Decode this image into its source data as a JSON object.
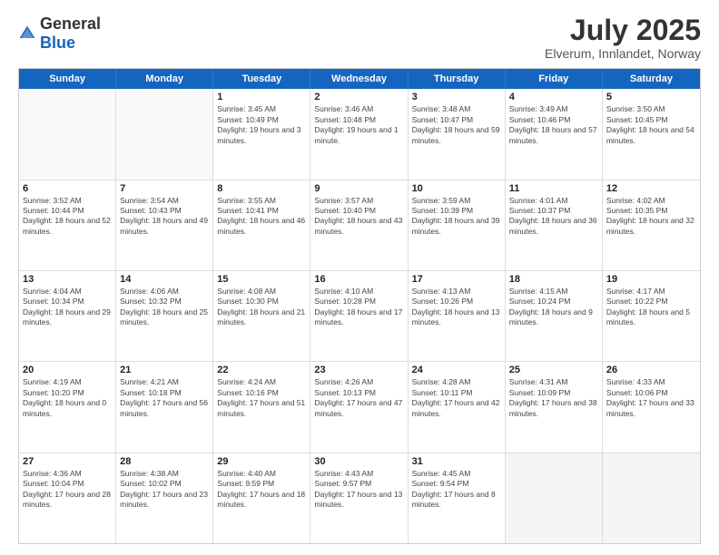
{
  "logo": {
    "general": "General",
    "blue": "Blue"
  },
  "header": {
    "month": "July 2025",
    "location": "Elverum, Innlandet, Norway"
  },
  "days_of_week": [
    "Sunday",
    "Monday",
    "Tuesday",
    "Wednesday",
    "Thursday",
    "Friday",
    "Saturday"
  ],
  "weeks": [
    [
      {
        "day": "",
        "empty": true
      },
      {
        "day": "",
        "empty": true
      },
      {
        "day": "1",
        "sunrise": "3:45 AM",
        "sunset": "10:49 PM",
        "daylight": "19 hours and 3 minutes."
      },
      {
        "day": "2",
        "sunrise": "3:46 AM",
        "sunset": "10:48 PM",
        "daylight": "19 hours and 1 minute."
      },
      {
        "day": "3",
        "sunrise": "3:48 AM",
        "sunset": "10:47 PM",
        "daylight": "18 hours and 59 minutes."
      },
      {
        "day": "4",
        "sunrise": "3:49 AM",
        "sunset": "10:46 PM",
        "daylight": "18 hours and 57 minutes."
      },
      {
        "day": "5",
        "sunrise": "3:50 AM",
        "sunset": "10:45 PM",
        "daylight": "18 hours and 54 minutes."
      }
    ],
    [
      {
        "day": "6",
        "sunrise": "3:52 AM",
        "sunset": "10:44 PM",
        "daylight": "18 hours and 52 minutes."
      },
      {
        "day": "7",
        "sunrise": "3:54 AM",
        "sunset": "10:43 PM",
        "daylight": "18 hours and 49 minutes."
      },
      {
        "day": "8",
        "sunrise": "3:55 AM",
        "sunset": "10:41 PM",
        "daylight": "18 hours and 46 minutes."
      },
      {
        "day": "9",
        "sunrise": "3:57 AM",
        "sunset": "10:40 PM",
        "daylight": "18 hours and 43 minutes."
      },
      {
        "day": "10",
        "sunrise": "3:59 AM",
        "sunset": "10:39 PM",
        "daylight": "18 hours and 39 minutes."
      },
      {
        "day": "11",
        "sunrise": "4:01 AM",
        "sunset": "10:37 PM",
        "daylight": "18 hours and 36 minutes."
      },
      {
        "day": "12",
        "sunrise": "4:02 AM",
        "sunset": "10:35 PM",
        "daylight": "18 hours and 32 minutes."
      }
    ],
    [
      {
        "day": "13",
        "sunrise": "4:04 AM",
        "sunset": "10:34 PM",
        "daylight": "18 hours and 29 minutes."
      },
      {
        "day": "14",
        "sunrise": "4:06 AM",
        "sunset": "10:32 PM",
        "daylight": "18 hours and 25 minutes."
      },
      {
        "day": "15",
        "sunrise": "4:08 AM",
        "sunset": "10:30 PM",
        "daylight": "18 hours and 21 minutes."
      },
      {
        "day": "16",
        "sunrise": "4:10 AM",
        "sunset": "10:28 PM",
        "daylight": "18 hours and 17 minutes."
      },
      {
        "day": "17",
        "sunrise": "4:13 AM",
        "sunset": "10:26 PM",
        "daylight": "18 hours and 13 minutes."
      },
      {
        "day": "18",
        "sunrise": "4:15 AM",
        "sunset": "10:24 PM",
        "daylight": "18 hours and 9 minutes."
      },
      {
        "day": "19",
        "sunrise": "4:17 AM",
        "sunset": "10:22 PM",
        "daylight": "18 hours and 5 minutes."
      }
    ],
    [
      {
        "day": "20",
        "sunrise": "4:19 AM",
        "sunset": "10:20 PM",
        "daylight": "18 hours and 0 minutes."
      },
      {
        "day": "21",
        "sunrise": "4:21 AM",
        "sunset": "10:18 PM",
        "daylight": "17 hours and 56 minutes."
      },
      {
        "day": "22",
        "sunrise": "4:24 AM",
        "sunset": "10:16 PM",
        "daylight": "17 hours and 51 minutes."
      },
      {
        "day": "23",
        "sunrise": "4:26 AM",
        "sunset": "10:13 PM",
        "daylight": "17 hours and 47 minutes."
      },
      {
        "day": "24",
        "sunrise": "4:28 AM",
        "sunset": "10:11 PM",
        "daylight": "17 hours and 42 minutes."
      },
      {
        "day": "25",
        "sunrise": "4:31 AM",
        "sunset": "10:09 PM",
        "daylight": "17 hours and 38 minutes."
      },
      {
        "day": "26",
        "sunrise": "4:33 AM",
        "sunset": "10:06 PM",
        "daylight": "17 hours and 33 minutes."
      }
    ],
    [
      {
        "day": "27",
        "sunrise": "4:36 AM",
        "sunset": "10:04 PM",
        "daylight": "17 hours and 28 minutes."
      },
      {
        "day": "28",
        "sunrise": "4:38 AM",
        "sunset": "10:02 PM",
        "daylight": "17 hours and 23 minutes."
      },
      {
        "day": "29",
        "sunrise": "4:40 AM",
        "sunset": "9:59 PM",
        "daylight": "17 hours and 18 minutes."
      },
      {
        "day": "30",
        "sunrise": "4:43 AM",
        "sunset": "9:57 PM",
        "daylight": "17 hours and 13 minutes."
      },
      {
        "day": "31",
        "sunrise": "4:45 AM",
        "sunset": "9:54 PM",
        "daylight": "17 hours and 8 minutes."
      },
      {
        "day": "",
        "empty": true
      },
      {
        "day": "",
        "empty": true
      }
    ]
  ],
  "labels": {
    "sunrise": "Sunrise:",
    "sunset": "Sunset:",
    "daylight": "Daylight:"
  }
}
